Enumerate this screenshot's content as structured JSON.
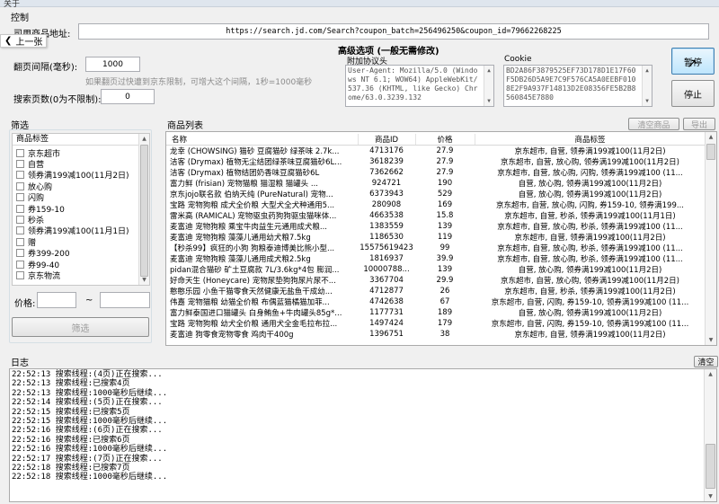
{
  "window": {
    "title": "关于"
  },
  "control": {
    "section_label": "控制",
    "url_label": "司用商品地址:",
    "url_value": "https://search.jd.com/Search?coupon_batch=256496250&coupon_id=79662268225",
    "back_label": "上一张",
    "page_interval_label": "翻页间隔(毫秒):",
    "page_interval_value": "1000",
    "hint": "如果翻页过快遭到京东限制，可增大这个间隔，1秒=1000毫秒",
    "search_pages_label": "搜索页数(0为不限制):",
    "search_pages_value": "0",
    "advanced_title": "高级选项 (一般无需修改)",
    "ua_label": "附加协议头",
    "ua_value": "User-Agent: Mozilla/5.0 (Windows NT 6.1; WOW64) AppleWebKit/537.36 (KHTML, like Gecko) Chrome/63.0.3239.132",
    "cookie_label": "Cookie",
    "cookie_value": "BD2A86F3879525EF73D178D1E17F60F5DB26D5A9E7C9F576CA5A0EEBF0108E2F9A937F14813D2E08356FE5B2B8560845E7880",
    "pause_button": "暂停",
    "stop_button": "停止"
  },
  "filter": {
    "section_label": "筛选",
    "list_header": "商品标签",
    "items": [
      "京东超市",
      "自营",
      "领券满199减100(11月2日)",
      "放心购",
      "闪购",
      "券159-10",
      "秒杀",
      "领券满199减100(11月1日)",
      "赠",
      "券399-200",
      "券99-40",
      "京东物流"
    ],
    "price_label": "价格:",
    "price_sep": "~",
    "filter_button": "筛选"
  },
  "products": {
    "section_label": "商品列表",
    "clear_button": "清空商品",
    "export_button": "导出",
    "columns": [
      "名称",
      "商品ID",
      "价格",
      "商品标签"
    ],
    "rows": [
      [
        "龙幸 (CHOWSING) 猫砂 豆腐猫砂 绿茶味 2.7k...",
        "4713176",
        "27.9",
        "京东超市, 自营, 领券满199减100(11月2日)"
      ],
      [
        "洁客 (Drymax) 植物无尘结团绿茶味豆腐猫砂6L...",
        "3618239",
        "27.9",
        "京东超市, 自营, 放心购, 领券满199减100(11月2日)"
      ],
      [
        "洁客 (Drymax) 植物结团奶香味豆腐猫砂6L",
        "7362662",
        "27.9",
        "京东超市, 自营, 放心购, 闪购, 领券满199减100 (11..."
      ],
      [
        "富力鲜 (frisian) 宠物猫粮 猫湿粮 猫罐头 ...",
        "924721",
        "190",
        "自营, 放心购, 领券满199减100(11月2日)"
      ],
      [
        "京东jojo联名款 伯纳天纯 (PureNatural) 宠物...",
        "6373943",
        "529",
        "自营, 放心购, 领券满199减100(11月2日)"
      ],
      [
        "宝路 宠物狗粮 成犬全价粮 大型犬全犬种通用5...",
        "280908",
        "169",
        "京东超市, 自营, 放心购, 闪购, 券159-10, 领券满199..."
      ],
      [
        "雷米高 (RAMICAL) 宠物驱虫药狗狗驱虫猫咪体...",
        "4663538",
        "15.8",
        "京东超市, 自营, 秒杀, 领券满199减100(11月1日)"
      ],
      [
        "麦富迪 宠物狗粮 乘宝牛肉益生元通用成犬粮...",
        "1383559",
        "139",
        "京东超市, 自营, 放心购, 秒杀, 领券满199减100 (11..."
      ],
      [
        "麦富迪 宠物狗粮 藻藻儿通用幼犬粮7.5kg",
        "1186530",
        "119",
        "京东超市, 自营, 领券满199减100(11月2日)"
      ],
      [
        "【秒杀99】疯狂的小狗 狗粮泰迪博美比熊小型...",
        "15575619423",
        "99",
        "京东超市, 自营, 放心购, 秒杀, 领券满199减100 (11..."
      ],
      [
        "麦富迪 宠物狗粮 藻藻儿通用成犬粮2.5kg",
        "1816937",
        "39.9",
        "京东超市, 自营, 放心购, 秒杀, 领券满199减100 (11..."
      ],
      [
        "pidan混合猫砂 矿土豆腐款 7L/3.6kg*4包 膨润...",
        "10000788...",
        "139",
        "自营, 放心购, 领券满199减100(11月2日)"
      ],
      [
        "好命天生 (Honeycare) 宠物尿垫狗狗尿片尿不...",
        "3367704",
        "29.9",
        "京东超市, 自营, 放心购, 领券满199减100(11月2日)"
      ],
      [
        "憨憨乐园 小鱼干猫零食天然健康无盐鱼干成幼...",
        "4712877",
        "26",
        "京东超市, 自营, 秒杀, 领券满199减100(11月2日)"
      ],
      [
        "伟嘉 宠物猫粮 幼猫全价粮 布偶蓝猫橘猫加菲...",
        "4742638",
        "67",
        "京东超市, 自营, 闪购, 券159-10, 领券满199减100 (11..."
      ],
      [
        "富力鲜泰国进口猫罐头 白身鲔鱼+牛肉罐头85g*...",
        "1177731",
        "189",
        "自营, 放心购, 领券满199减100(11月2日)"
      ],
      [
        "宝路 宠物狗粮 幼犬全价粮 通用犬全金毛拉布拉...",
        "1497424",
        "179",
        "京东超市, 自营, 闪购, 券159-10, 领券满199减100 (11..."
      ],
      [
        "麦富迪 狗零食宠物零食 鸡肉干400g",
        "1396751",
        "38",
        "京东超市, 自营, 领券满199减100(11月2日)"
      ]
    ]
  },
  "log": {
    "section_label": "日志",
    "clear_button": "清空",
    "lines": [
      "22:52:13 搜索线程:(4页)正在搜索...",
      "22:52:13 搜索线程:已搜索4页",
      "22:52:13 搜索线程:1000毫秒后继续...",
      "22:52:14 搜索线程:(5页)正在搜索...",
      "22:52:15 搜索线程:已搜索5页",
      "22:52:15 搜索线程:1000毫秒后继续...",
      "22:52:16 搜索线程:(6页)正在搜索...",
      "22:52:16 搜索线程:已搜索6页",
      "22:52:16 搜索线程:1000毫秒后继续...",
      "22:52:17 搜索线程:(7页)正在搜索...",
      "22:52:18 搜索线程:已搜索7页",
      "22:52:18 搜索线程:1000毫秒后继续..."
    ]
  }
}
